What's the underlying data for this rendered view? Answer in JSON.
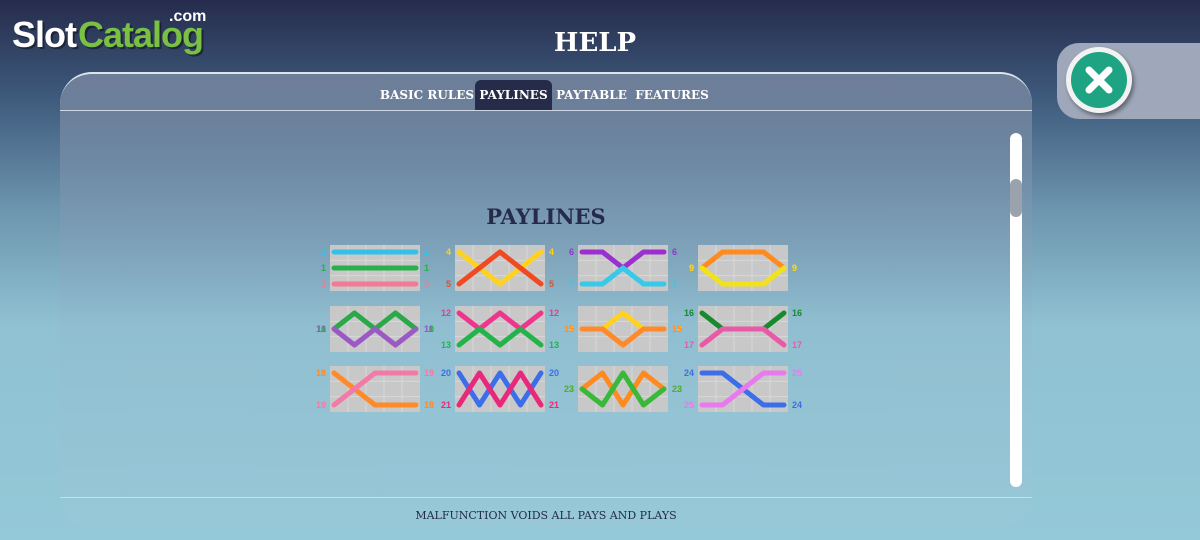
{
  "logo": {
    "slot": "Slot",
    "catalog": "Catalog",
    "com": ".com"
  },
  "header": {
    "title": "HELP"
  },
  "tabs": [
    {
      "label": "BASIC RULES"
    },
    {
      "label": "PAYLINES"
    },
    {
      "label": "PAYTABLE"
    },
    {
      "label": "FEATURES"
    }
  ],
  "active_tab": "PAYLINES",
  "section": {
    "title": "PAYLINES"
  },
  "footer": {
    "text": "MALFUNCTION VOIDS ALL PAYS AND PLAYS"
  },
  "icons": {
    "close": "close-x-icon"
  },
  "colors": {
    "accent": "#262b4a",
    "close_button": "#1ea483",
    "grid": "#c8c8c8"
  },
  "paylines": [
    {
      "id": 1,
      "rows": [
        1,
        1,
        1,
        1,
        1
      ],
      "color": "#28b04a"
    },
    {
      "id": 2,
      "rows": [
        0,
        0,
        0,
        0,
        0
      ],
      "color": "#35c0e8"
    },
    {
      "id": 3,
      "rows": [
        2,
        2,
        2,
        2,
        2
      ],
      "color": "#f27a95"
    },
    {
      "id": 4,
      "rows": [
        0,
        1,
        2,
        1,
        0
      ],
      "color": "#ffd21f"
    },
    {
      "id": 5,
      "rows": [
        2,
        1,
        0,
        1,
        2
      ],
      "color": "#f04a23"
    },
    {
      "id": 6,
      "rows": [
        0,
        0,
        1,
        0,
        0
      ],
      "color": "#9b2fcf"
    },
    {
      "id": 7,
      "rows": [
        2,
        2,
        1,
        2,
        2
      ],
      "color": "#38c8e8"
    },
    {
      "id": 8,
      "rows": [
        1,
        0,
        0,
        0,
        1
      ],
      "color": "#ff8a1f"
    },
    {
      "id": 9,
      "rows": [
        1,
        2,
        2,
        2,
        1
      ],
      "color": "#f2e21a"
    },
    {
      "id": 10,
      "rows": [
        1,
        0,
        1,
        0,
        1
      ],
      "color": "#2aa84a"
    },
    {
      "id": 11,
      "rows": [
        1,
        2,
        1,
        2,
        1
      ],
      "color": "#9b59c4"
    },
    {
      "id": 12,
      "rows": [
        0,
        1,
        0,
        1,
        0
      ],
      "color": "#f0368c"
    },
    {
      "id": 13,
      "rows": [
        2,
        1,
        2,
        1,
        2
      ],
      "color": "#22b34a"
    },
    {
      "id": 14,
      "rows": [
        1,
        1,
        0,
        1,
        1
      ],
      "color": "#ffd21f"
    },
    {
      "id": 15,
      "rows": [
        1,
        1,
        2,
        1,
        1
      ],
      "color": "#ff8a2a"
    },
    {
      "id": 16,
      "rows": [
        0,
        1,
        1,
        1,
        0
      ],
      "color": "#178a2e"
    },
    {
      "id": 17,
      "rows": [
        2,
        1,
        1,
        1,
        2
      ],
      "color": "#e85aa8"
    },
    {
      "id": 18,
      "rows": [
        0,
        1,
        2,
        2,
        2
      ],
      "color": "#ff8a2a"
    },
    {
      "id": 19,
      "rows": [
        2,
        1,
        0,
        0,
        0
      ],
      "color": "#f27aa8"
    },
    {
      "id": 20,
      "rows": [
        0,
        2,
        0,
        2,
        0
      ],
      "color": "#3b6ee8"
    },
    {
      "id": 21,
      "rows": [
        2,
        0,
        2,
        0,
        2
      ],
      "color": "#e8287a"
    },
    {
      "id": 22,
      "rows": [
        1,
        0,
        2,
        0,
        1
      ],
      "color": "#ff8a1f"
    },
    {
      "id": 23,
      "rows": [
        1,
        2,
        0,
        2,
        1
      ],
      "color": "#3ab83a"
    },
    {
      "id": 24,
      "rows": [
        0,
        0,
        1,
        2,
        2
      ],
      "color": "#3b6ee8"
    },
    {
      "id": 25,
      "rows": [
        2,
        2,
        1,
        0,
        0
      ],
      "color": "#e87aee"
    }
  ],
  "payline_groups": [
    {
      "left": [
        "2",
        "1",
        "3"
      ],
      "right": [
        "2",
        "1",
        "3"
      ],
      "lines": [
        1,
        2,
        3
      ]
    },
    {
      "left": [
        "4",
        "5"
      ],
      "right": [
        "4",
        "5"
      ],
      "lines": [
        4,
        5
      ]
    },
    {
      "left": [
        "6",
        "7"
      ],
      "right": [
        "6",
        "7"
      ],
      "lines": [
        6,
        7
      ]
    },
    {
      "left": [
        "8",
        "9"
      ],
      "right": [
        "8",
        "9"
      ],
      "lines": [
        8,
        9
      ]
    },
    {
      "left": [
        "10",
        "11"
      ],
      "right": [
        "10",
        "11"
      ],
      "lines": [
        10,
        11
      ]
    },
    {
      "left": [
        "12",
        "13"
      ],
      "right": [
        "12",
        "13"
      ],
      "lines": [
        12,
        13
      ]
    },
    {
      "left": [
        "14",
        "15"
      ],
      "right": [
        "14",
        "15"
      ],
      "lines": [
        14,
        15
      ]
    },
    {
      "left": [
        "16",
        "17"
      ],
      "right": [
        "16",
        "17"
      ],
      "lines": [
        16,
        17
      ]
    },
    {
      "left": [
        "18",
        "19"
      ],
      "right": [
        "19",
        "18"
      ],
      "lines": [
        18,
        19
      ]
    },
    {
      "left": [
        "20",
        "21"
      ],
      "right": [
        "20",
        "21"
      ],
      "lines": [
        20,
        21
      ]
    },
    {
      "left": [
        "22",
        "23"
      ],
      "right": [
        "22",
        "23"
      ],
      "lines": [
        22,
        23
      ]
    },
    {
      "left": [
        "24",
        "25"
      ],
      "right": [
        "25",
        "24"
      ],
      "lines": [
        24,
        25
      ]
    }
  ]
}
